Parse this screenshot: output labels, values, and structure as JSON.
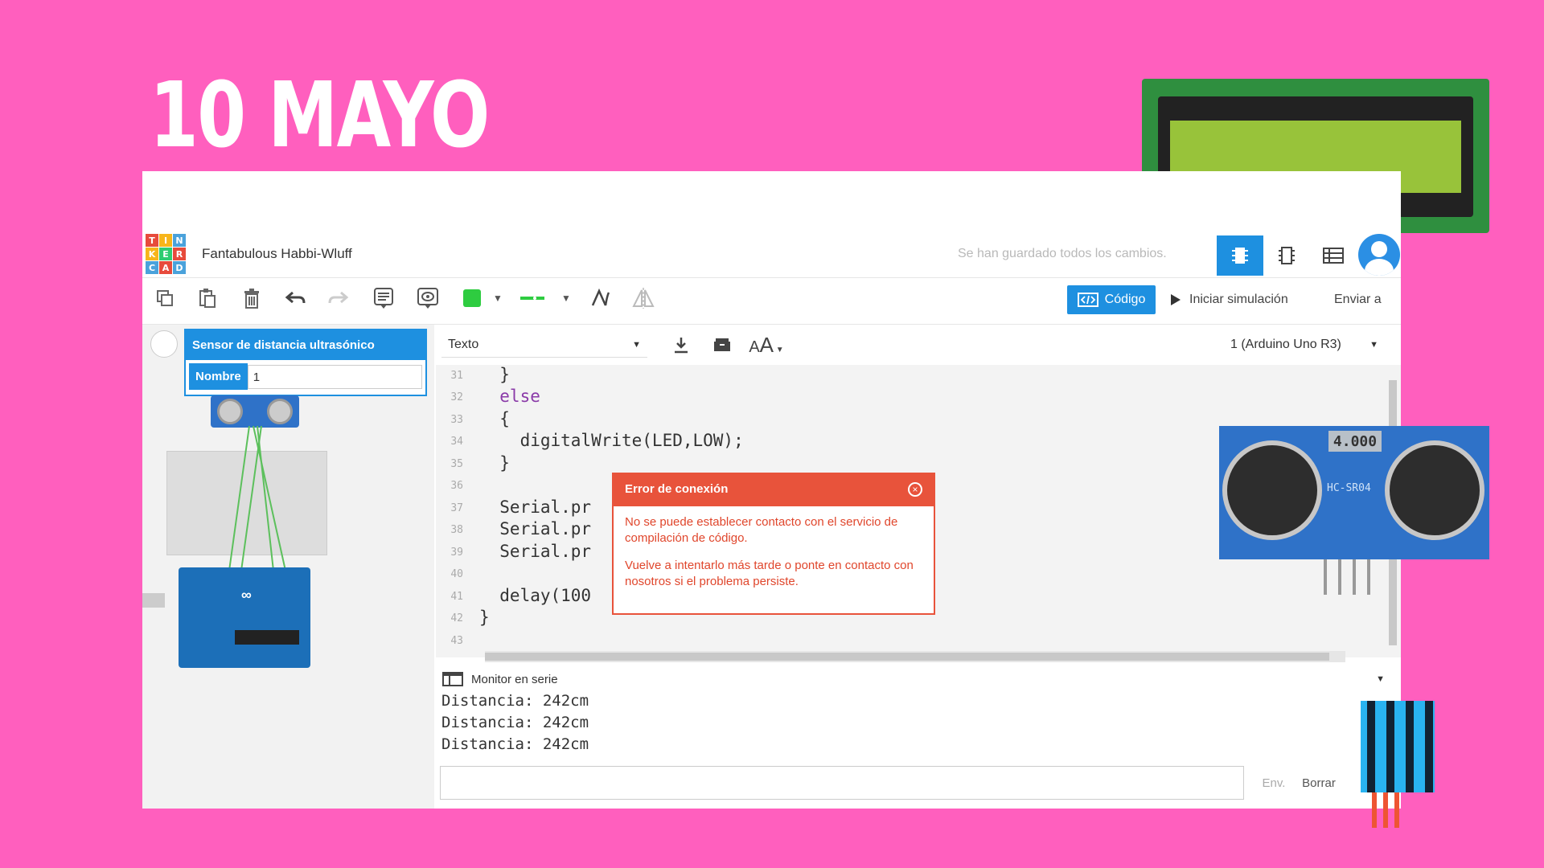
{
  "slide": {
    "title": "10 MAYO"
  },
  "app": {
    "logo_letters": [
      "T",
      "I",
      "N",
      "K",
      "E",
      "R",
      "C",
      "A",
      "D"
    ],
    "logo_colors": [
      "#e74b3c",
      "#f7b51a",
      "#4aa2db",
      "#f7b51a",
      "#2ecc71",
      "#e74b3c",
      "#4aa2db",
      "#e74b3c",
      "#4aa2db"
    ],
    "project_name": "Fantabulous Habbi-Wluff",
    "saved_status": "Se han guardado todos los cambios.",
    "header_icons": [
      "circuit-view-icon",
      "schematic-view-icon",
      "component-list-icon"
    ],
    "accent": "#1e90e0"
  },
  "toolbar": {
    "code_label": "Código",
    "sim_label": "Iniciar simulación",
    "send_label": "Enviar a",
    "color_swatch": "#2ecc40"
  },
  "properties": {
    "title": "Sensor de distancia ultrasónico",
    "name_label": "Nombre",
    "name_value": "1"
  },
  "editor": {
    "mode": "Texto",
    "board": "1 (Arduino Uno R3)",
    "lines": [
      {
        "n": "31",
        "code": "  }"
      },
      {
        "n": "32",
        "code": "  else"
      },
      {
        "n": "33",
        "code": "  {"
      },
      {
        "n": "34",
        "code": "    digitalWrite(LED,LOW);"
      },
      {
        "n": "35",
        "code": "  }"
      },
      {
        "n": "36",
        "code": ""
      },
      {
        "n": "37",
        "code": "  Serial.pr"
      },
      {
        "n": "38",
        "code": "  Serial.pr"
      },
      {
        "n": "39",
        "code": "  Serial.pr"
      },
      {
        "n": "40",
        "code": ""
      },
      {
        "n": "41",
        "code": "  delay(100"
      },
      {
        "n": "42",
        "code": "}"
      },
      {
        "n": "43",
        "code": ""
      }
    ]
  },
  "serial": {
    "title": "Monitor en serie",
    "lines": [
      "Distancia: 242cm",
      "Distancia: 242cm",
      "Distancia: 242cm"
    ],
    "send_label": "Env.",
    "clear_label": "Borrar"
  },
  "dialog": {
    "title": "Error de conexión",
    "message_1": "No se puede establecer contacto con el servicio de compilación de código.",
    "message_2": "Vuelve a intentarlo más tarde o ponte en contacto con nosotros si el problema persiste.",
    "color": "#e8533b"
  },
  "decor": {
    "sensor_display": "4.000",
    "sensor_label": "HC-SR04"
  }
}
